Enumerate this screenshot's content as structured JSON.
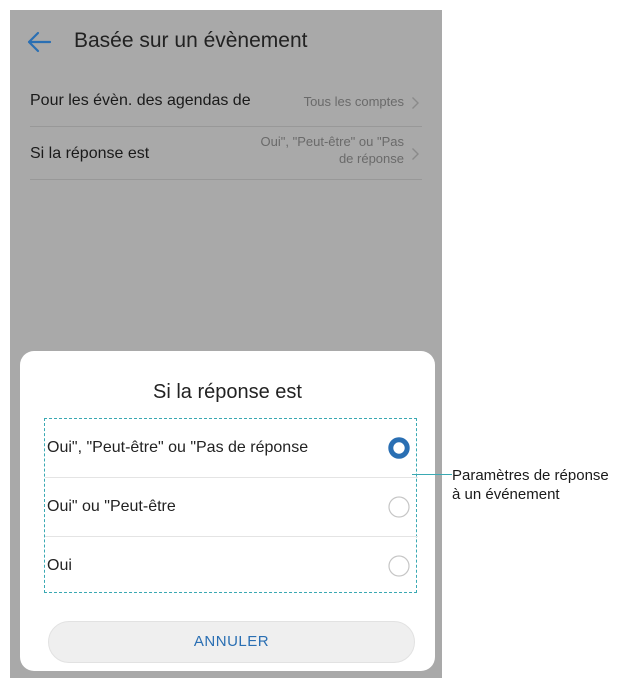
{
  "header": {
    "title": "Basée sur un évènement"
  },
  "settings": [
    {
      "label": "Pour les évèn. des agendas de",
      "value": "Tous les comptes"
    },
    {
      "label": "Si la réponse est",
      "value": "Oui\", \"Peut-être\" ou \"Pas de réponse"
    }
  ],
  "dialog": {
    "title": "Si la réponse est",
    "options": [
      {
        "label": "Oui\", \"Peut-être\" ou \"Pas de réponse",
        "selected": true
      },
      {
        "label": "Oui\" ou \"Peut-être",
        "selected": false
      },
      {
        "label": "Oui",
        "selected": false
      }
    ],
    "cancel_label": "ANNULER"
  },
  "annotation": {
    "line1": "Paramètres de réponse",
    "line2": "à un événement"
  },
  "colors": {
    "accent": "#2a6fb3",
    "radio_selected": "#2a6fb3",
    "callout": "#3aa9b3",
    "dim_background": "#a9a9a9"
  }
}
